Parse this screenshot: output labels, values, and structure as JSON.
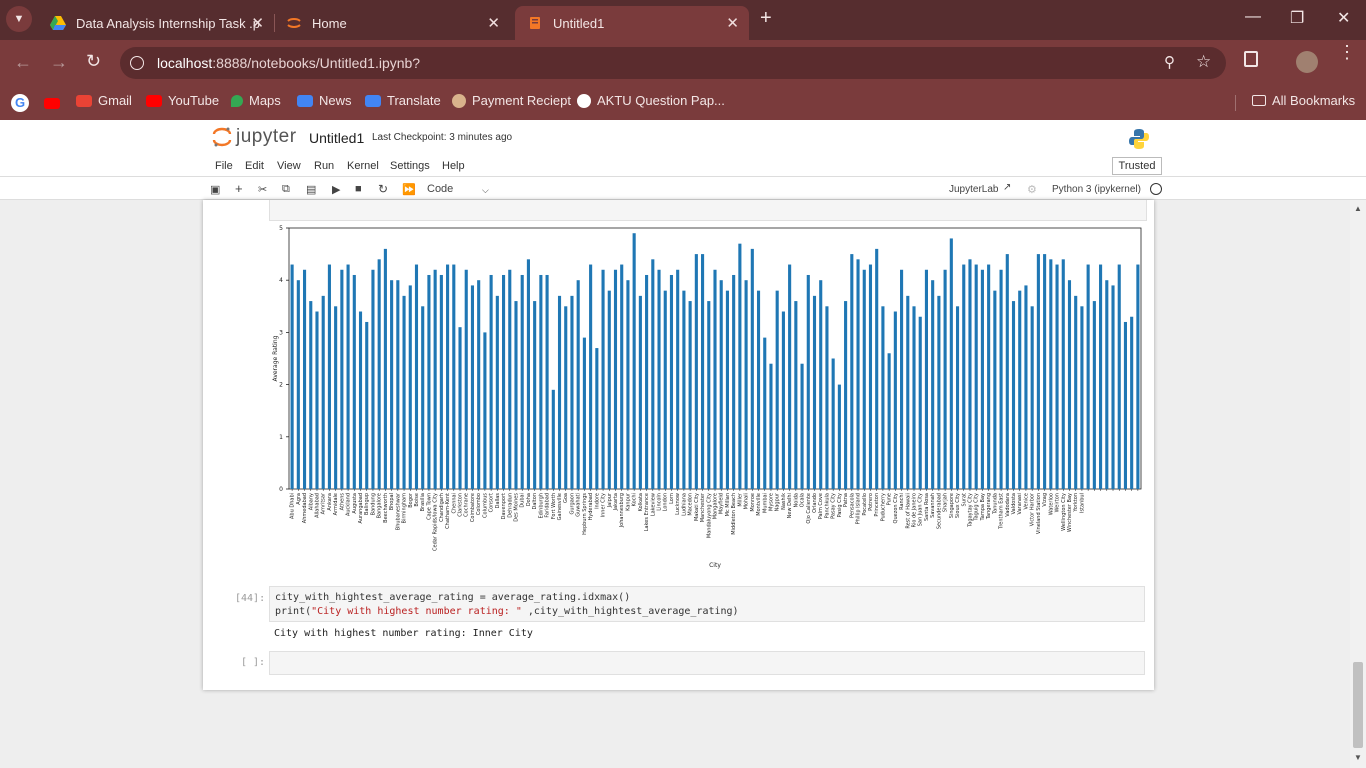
{
  "browser": {
    "tabs": [
      {
        "title": "Data Analysis Internship Task .p",
        "active": false
      },
      {
        "title": "Home",
        "active": false
      },
      {
        "title": "Untitled1",
        "active": true
      }
    ],
    "url_host": "localhost",
    "url_rest": ":8888/notebooks/Untitled1.ipynb?",
    "bookmarks": [
      "Gmail",
      "YouTube",
      "Maps",
      "News",
      "Translate",
      "Payment Reciept",
      "AKTU Question Pap..."
    ],
    "all_bookmarks": "All Bookmarks"
  },
  "jupyter": {
    "logo": "jupyter",
    "notebook_name": "Untitled1",
    "checkpoint": "Last Checkpoint: 3 minutes ago",
    "menu": [
      "File",
      "Edit",
      "View",
      "Run",
      "Kernel",
      "Settings",
      "Help"
    ],
    "trusted": "Trusted",
    "cell_type": "Code",
    "jupyterlab": "JupyterLab",
    "kernel": "Python 3 (ipykernel)"
  },
  "cells": {
    "c44_prompt": "[44]:",
    "c44_line1": "city_with_hightest_average_rating = average_rating.idxmax()",
    "c44_line2_a": "print(",
    "c44_line2_str": "\"City with highest number rating: \"",
    "c44_line2_b": " ,city_with_hightest_average_rating)",
    "c44_output": "City with highest number rating:  Inner City",
    "empty_prompt": "[ ]:"
  },
  "chart_data": {
    "type": "bar",
    "xlabel": "City",
    "ylabel": "Average Rating",
    "ylim": [
      0,
      5
    ],
    "yticks": [
      0,
      1,
      2,
      3,
      4,
      5
    ],
    "color": "#1f77b4",
    "categories": [
      "Abu Dhabi",
      "Agra",
      "Ahmedabad",
      "Albany",
      "Allahabad",
      "Amritsar",
      "Ankara",
      "Armidale",
      "Athens",
      "Auckland",
      "Augusta",
      "Aurangabad",
      "Balingup",
      "Bandung",
      "Bangalore",
      "Beechworth",
      "Bhopal",
      "Bhubaneshwar",
      "Birmingham",
      "Bogor",
      "Boise",
      "Brasilia",
      "Cape Town",
      "Cedar Rapids/Iowa City",
      "Chandigarh",
      "Chatham-Kent",
      "Chennai",
      "Clarkston",
      "Cochrane",
      "Coimbatore",
      "Colombo",
      "Columbus",
      "Consort",
      "Dallas",
      "Davenport",
      "Dehradun",
      "Des Moines",
      "Dubai",
      "Doha",
      "Dalton",
      "Edinburgh",
      "Faridabad",
      "Fort Worth",
      "Gainesville",
      "Goa",
      "Gurgaon",
      "Guwahati",
      "Hepburn Springs",
      "Hyderabad",
      "Indore",
      "Inner City",
      "Jaipur",
      "Jakarta",
      "Johannesburg",
      "Kanpur",
      "Kochi",
      "Kolkata",
      "Lakes Entrance",
      "Lakeview",
      "Lincoln",
      "London",
      "Lorn",
      "Lucknow",
      "Ludhiana",
      "Macedon",
      "Makati City",
      "Manchester",
      "Mandaluyong City",
      "Mangalore",
      "Mayfield",
      "Mc Millan",
      "Middleton Beach",
      "Miller",
      "Mohali",
      "Monroe",
      "Montville",
      "Mumbai",
      "Mysore",
      "Nagpur",
      "Nashik",
      "New Delhi",
      "Noida",
      "Ocala",
      "Ojo Caliente",
      "Orlando",
      "Palm Cove",
      "Panchkula",
      "Pasay City",
      "Pasig City",
      "Patna",
      "Pensacola",
      "Phillip Island",
      "Pocatello",
      "Potrero",
      "Princeton",
      "Puducherry",
      "Pune",
      "Quezon City",
      "Ranchi",
      "Rest of Hawaii",
      "Rio de Janeiro",
      "San Juan City",
      "Santa Rosa",
      "Savannah",
      "Secunderabad",
      "Sharjah",
      "Singapore",
      "Sioux City",
      "Surat",
      "Tagaytay City",
      "Taguig City",
      "Tampa Bay",
      "Tangerang",
      "Tanunda",
      "Trentham East",
      "Vadodara",
      "Valdosta",
      "Varanasi",
      "Venice",
      "Victor Harbor",
      "Vineland Station",
      "Vizag",
      "Waterloo",
      "Weirton",
      "Wellington City",
      "Winchester Bay",
      "Yorkton",
      "Istanbul"
    ],
    "values": [
      4.3,
      4.0,
      4.2,
      3.6,
      3.4,
      3.7,
      4.3,
      3.5,
      4.2,
      4.3,
      4.1,
      3.4,
      3.2,
      4.2,
      4.4,
      4.6,
      4.0,
      4.0,
      3.7,
      3.9,
      4.3,
      3.5,
      4.1,
      4.2,
      4.1,
      4.3,
      4.3,
      3.1,
      4.2,
      3.9,
      4.0,
      3.0,
      4.1,
      3.7,
      4.1,
      4.2,
      3.6,
      4.1,
      4.4,
      3.6,
      4.1,
      4.1,
      1.9,
      3.7,
      3.5,
      3.7,
      4.0,
      2.9,
      4.3,
      2.7,
      4.2,
      3.8,
      4.2,
      4.3,
      4.0,
      4.9,
      3.7,
      4.1,
      4.4,
      4.2,
      3.8,
      4.1,
      4.2,
      3.8,
      3.6,
      4.5,
      4.5,
      3.6,
      4.2,
      4.0,
      3.8,
      4.1,
      4.7,
      4.0,
      4.6,
      3.8,
      2.9,
      2.4,
      3.8,
      3.4,
      4.3,
      3.6,
      2.4,
      4.1,
      3.7,
      4.0,
      3.5,
      2.5,
      2.0,
      3.6,
      4.5,
      4.4,
      4.2,
      4.3,
      4.6,
      3.5,
      2.6,
      3.4,
      4.2,
      3.7,
      3.5,
      3.3,
      4.2,
      4.0,
      3.7,
      4.2,
      4.8,
      3.5,
      4.3,
      4.4,
      4.3,
      4.2,
      4.3,
      3.8,
      4.2,
      4.5,
      3.6,
      3.8,
      3.9,
      3.5,
      4.5,
      4.5,
      4.4,
      4.3,
      4.4,
      4.0,
      3.7,
      3.5,
      4.3,
      3.6,
      4.3,
      4.0,
      3.9,
      4.3,
      3.2,
      3.3,
      4.3
    ]
  }
}
